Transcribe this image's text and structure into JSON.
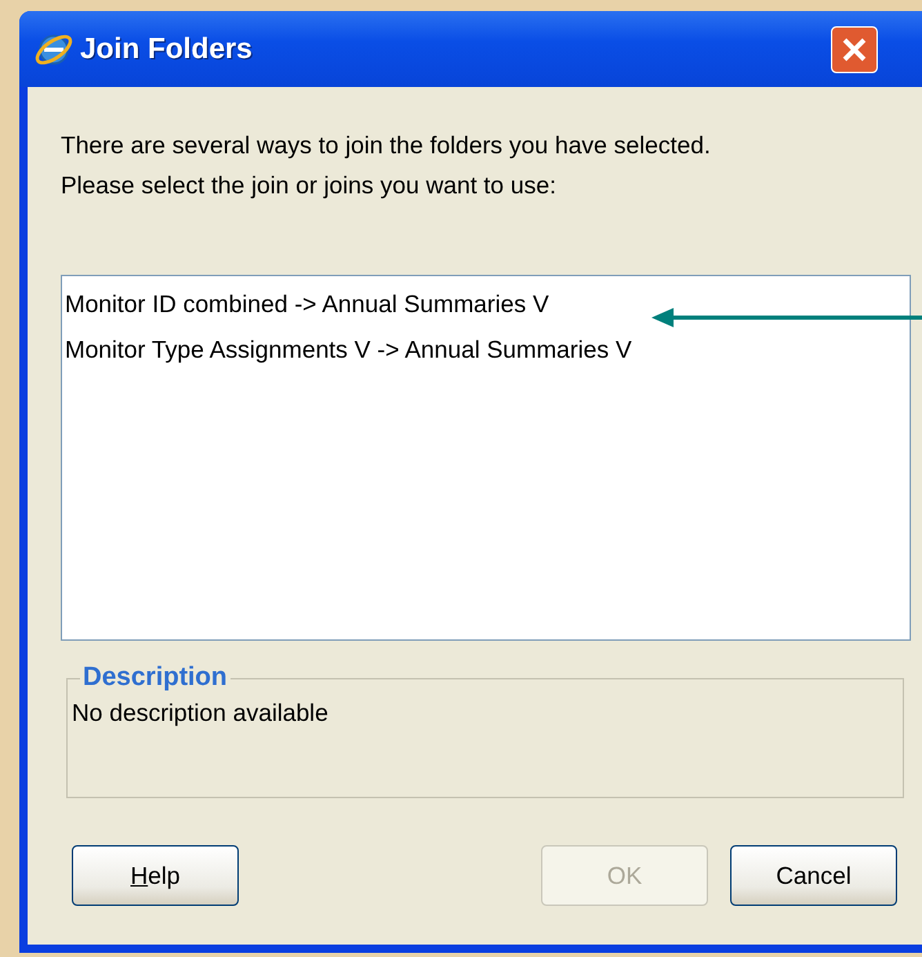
{
  "window": {
    "title": "Join Folders"
  },
  "instructions": [
    "There are several ways to join the folders you have selected.",
    "Please select the join or joins you want to use:"
  ],
  "joins": [
    "Monitor ID combined -> Annual Summaries V",
    "Monitor Type Assignments V -> Annual Summaries V"
  ],
  "description": {
    "legend": "Description",
    "text": "No description available"
  },
  "buttons": [
    {
      "label": "Help",
      "underline_first": true,
      "disabled": false
    },
    {
      "label": "OK",
      "underline_first": false,
      "disabled": true
    },
    {
      "label": "Cancel",
      "underline_first": false,
      "disabled": false
    }
  ]
}
